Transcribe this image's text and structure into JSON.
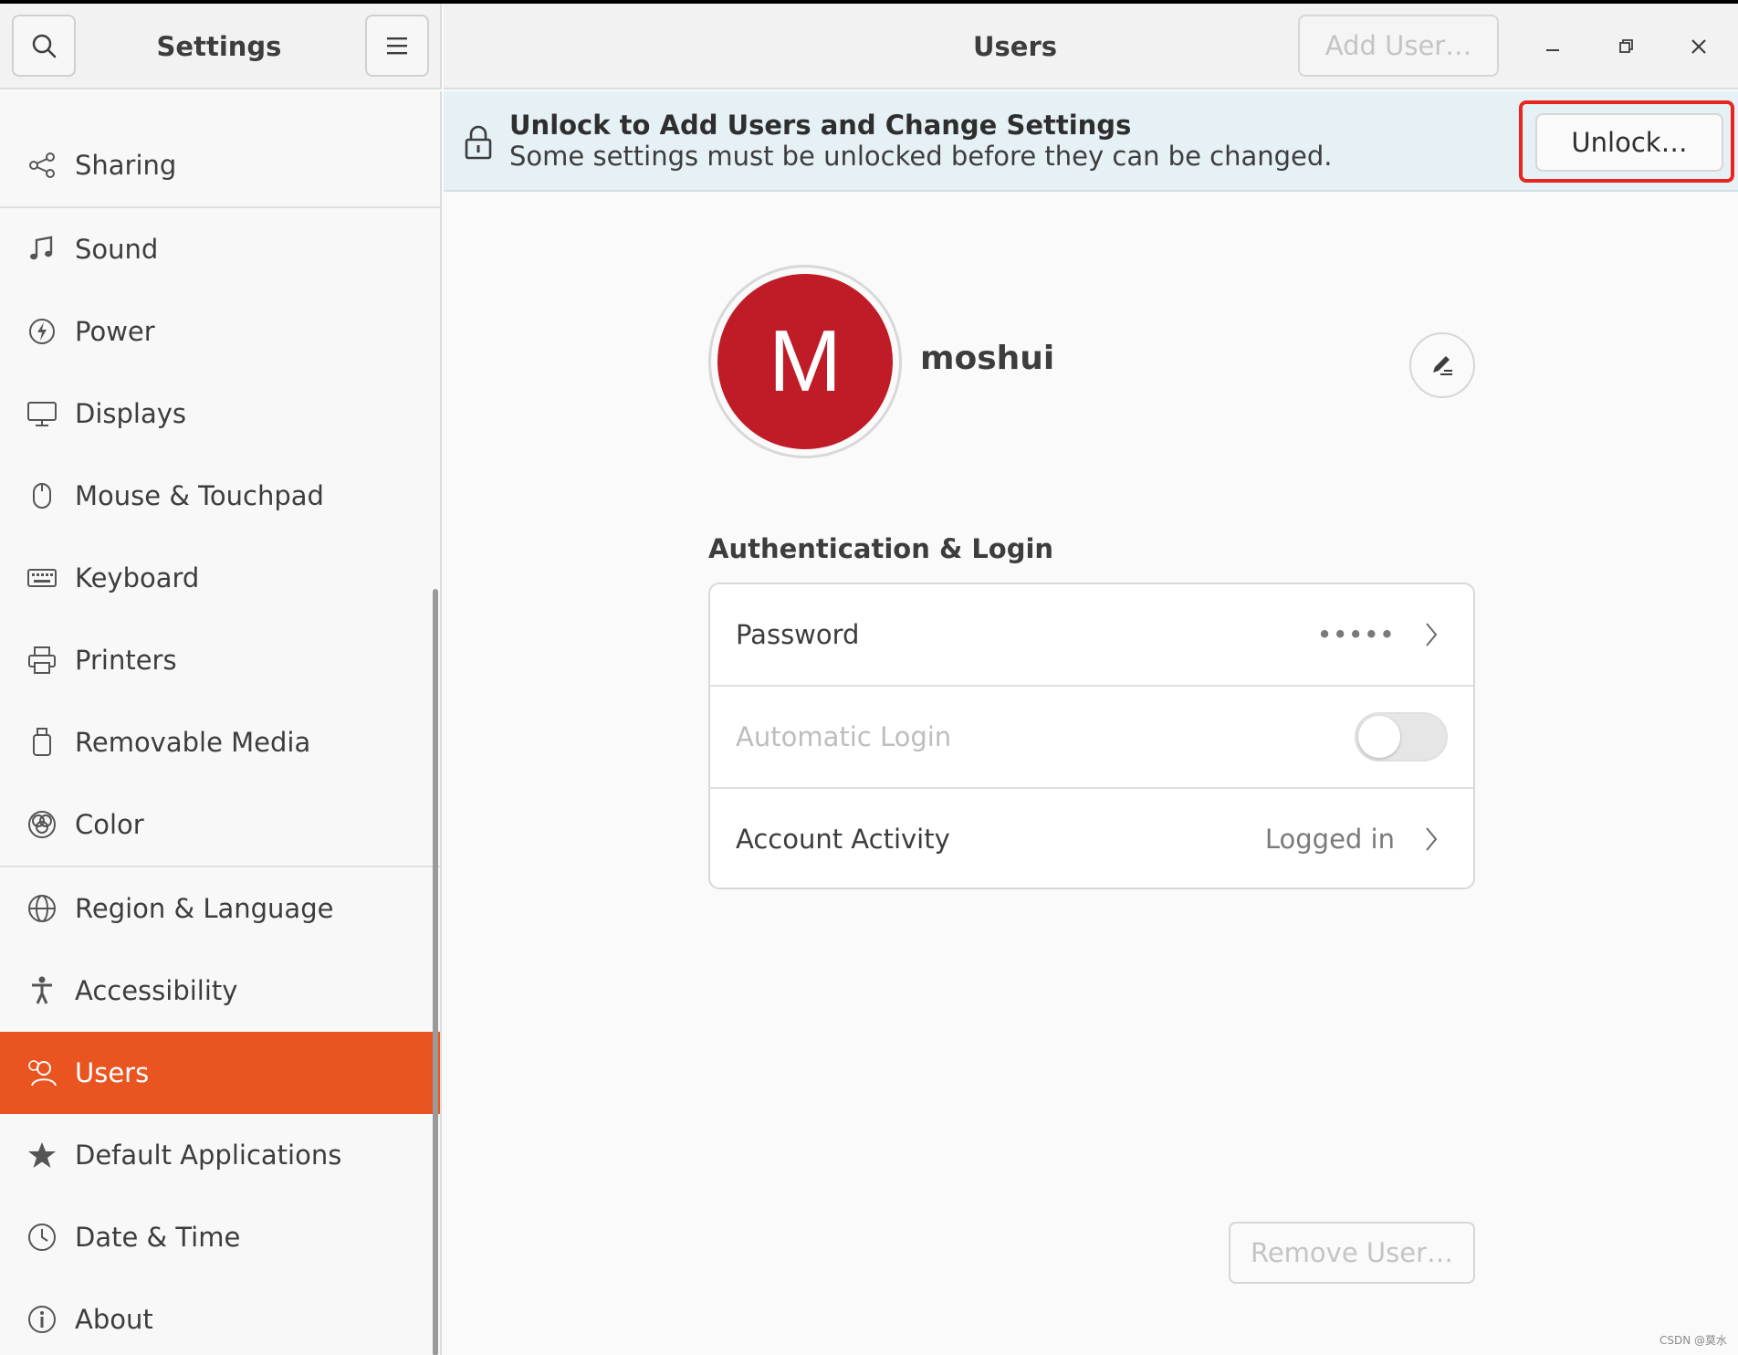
{
  "app": {
    "title": "Settings"
  },
  "header": {
    "search_icon": "search-icon",
    "menu_icon": "hamburger-menu-icon",
    "page_title": "Users",
    "add_user_label": "Add User…"
  },
  "window_controls": {
    "minimize": "minimize-icon",
    "maximize": "maximize-icon",
    "close": "close-icon"
  },
  "sidebar": {
    "items": [
      {
        "label": "Sharing",
        "icon": "share-icon"
      },
      {
        "label": "Sound",
        "icon": "music-note-icon"
      },
      {
        "label": "Power",
        "icon": "power-icon"
      },
      {
        "label": "Displays",
        "icon": "display-icon"
      },
      {
        "label": "Mouse & Touchpad",
        "icon": "mouse-icon"
      },
      {
        "label": "Keyboard",
        "icon": "keyboard-icon"
      },
      {
        "label": "Printers",
        "icon": "printer-icon"
      },
      {
        "label": "Removable Media",
        "icon": "removable-media-icon"
      },
      {
        "label": "Color",
        "icon": "color-icon"
      },
      {
        "label": "Region & Language",
        "icon": "globe-icon"
      },
      {
        "label": "Accessibility",
        "icon": "accessibility-icon"
      },
      {
        "label": "Users",
        "icon": "users-icon",
        "active": true
      },
      {
        "label": "Default Applications",
        "icon": "star-icon"
      },
      {
        "label": "Date & Time",
        "icon": "clock-icon"
      },
      {
        "label": "About",
        "icon": "info-icon"
      }
    ]
  },
  "infobar": {
    "title": "Unlock to Add Users and Change Settings",
    "subtitle": "Some settings must be unlocked before they can be changed.",
    "unlock_label": "Unlock…"
  },
  "user": {
    "avatar_letter": "M",
    "avatar_color": "#c01c28",
    "name": "moshui"
  },
  "auth": {
    "heading": "Authentication & Login",
    "password_label": "Password",
    "password_value": "•••••",
    "auto_login_label": "Automatic Login",
    "auto_login_enabled": false,
    "activity_label": "Account Activity",
    "activity_value": "Logged in"
  },
  "footer": {
    "remove_user_label": "Remove User…"
  },
  "colors": {
    "accent": "#e95420",
    "highlight": "#e8251e"
  },
  "watermark": "CSDN @莫水"
}
